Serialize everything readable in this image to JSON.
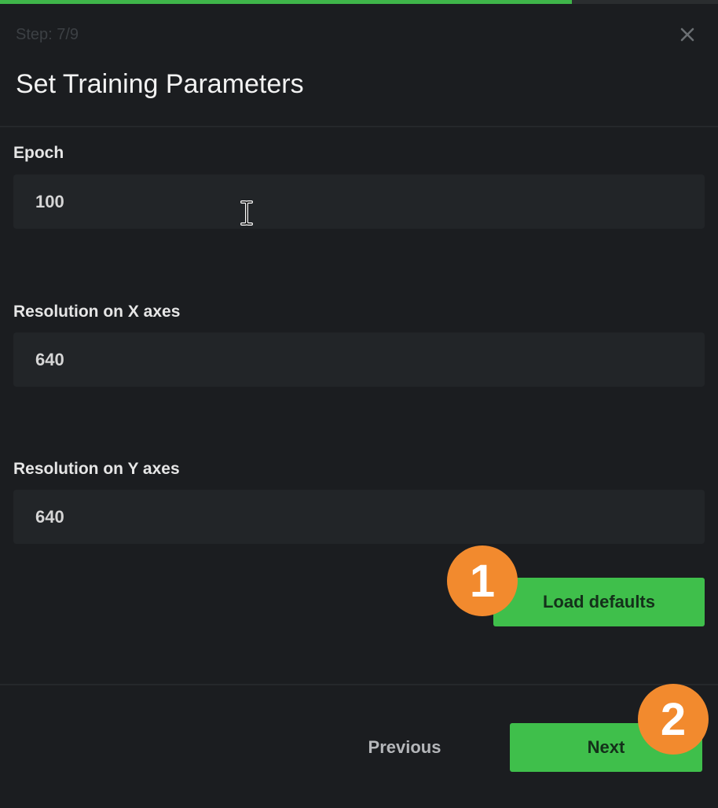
{
  "progress": {
    "fraction": 0.796,
    "fill_color": "#3fb54a"
  },
  "header": {
    "step_label": "Step: 7/9",
    "title": "Set Training Parameters",
    "close_icon": "close-icon"
  },
  "fields": {
    "epoch": {
      "label": "Epoch",
      "value": "100"
    },
    "resolution_x": {
      "label": "Resolution on X axes",
      "value": "640"
    },
    "resolution_y": {
      "label": "Resolution on Y axes",
      "value": "640"
    }
  },
  "actions": {
    "load_defaults_label": "Load defaults",
    "previous_label": "Previous",
    "next_label": "Next"
  },
  "annotations": {
    "badge_1": "1",
    "badge_2": "2",
    "badge_color": "#f28a2e"
  },
  "colors": {
    "accent": "#3fbf4b",
    "background": "#1b1d20"
  },
  "cursor_icon": "text-cursor-icon"
}
